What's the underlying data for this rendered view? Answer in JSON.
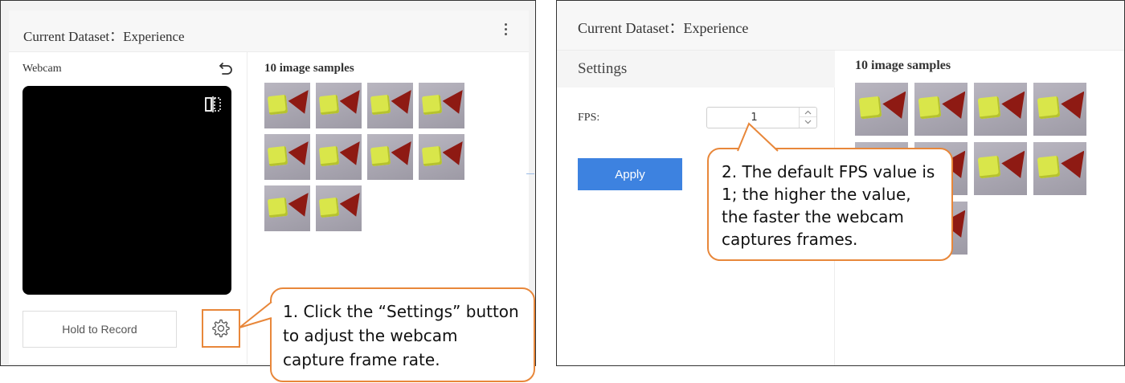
{
  "left_panel": {
    "header": {
      "dataset_title": "Current Dataset：Experience",
      "menu_icon": "kebab-menu-icon"
    },
    "webcam": {
      "label": "Webcam",
      "reset_icon": "undo-icon",
      "flip_icon": "flip-horizontal-icon",
      "record_button_label": "Hold to Record",
      "settings_icon": "gear-icon"
    },
    "samples": {
      "label": "10 image samples",
      "count": 10
    }
  },
  "right_panel": {
    "header": {
      "dataset_title": "Current Dataset：Experience"
    },
    "settings": {
      "title": "Settings",
      "fps_label": "FPS:",
      "fps_value": "1",
      "apply_button_label": "Apply"
    },
    "samples": {
      "label": "10 image samples",
      "visible_count": 8
    }
  },
  "callouts": {
    "step_1": "1. Click the “Settings” button to adjust the webcam capture frame rate.",
    "step_2": "2. The default FPS value is 1; the higher the value, the faster the webcam captures frames."
  },
  "colors": {
    "callout_border": "#e8873a",
    "apply_button": "#3d82e0",
    "video_background": "#000000"
  }
}
